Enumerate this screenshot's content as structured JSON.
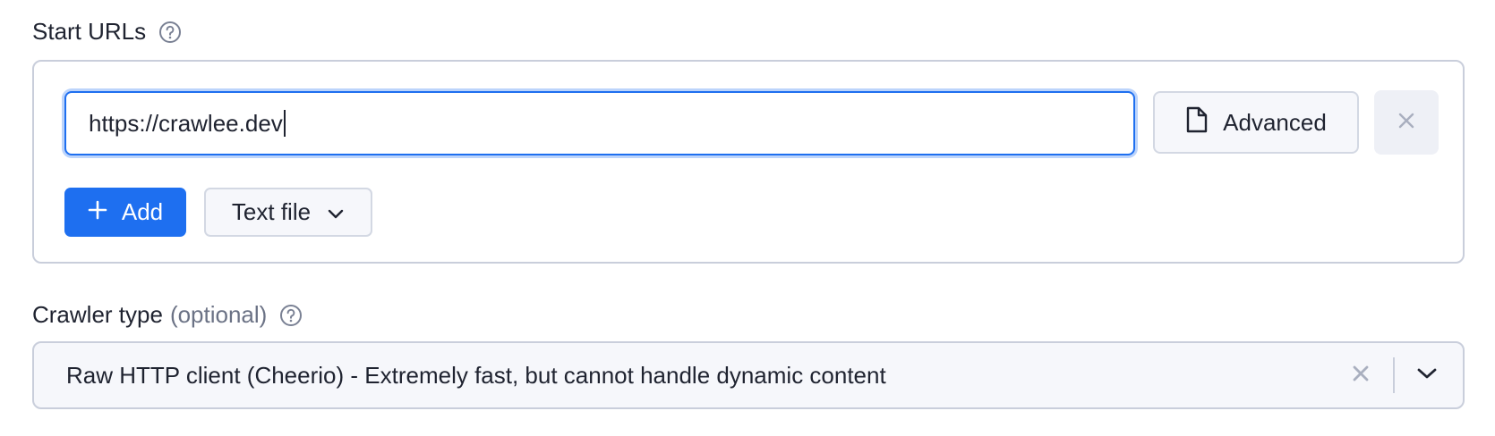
{
  "start_urls": {
    "label": "Start URLs",
    "help_icon": "question-circle-icon",
    "url_value": "https://crawlee.dev",
    "advanced_label": "Advanced",
    "advanced_icon": "file-icon",
    "remove_icon": "close-icon",
    "add_label": "Add",
    "add_icon": "plus-icon",
    "textfile_label": "Text file",
    "textfile_icon": "chevron-down-icon"
  },
  "crawler_type": {
    "label": "Crawler type",
    "optional": "(optional)",
    "help_icon": "question-circle-icon",
    "value": "Raw HTTP client (Cheerio) - Extremely fast, but cannot handle dynamic content",
    "clear_icon": "close-icon",
    "toggle_icon": "chevron-down-icon"
  },
  "colors": {
    "accent": "#1e6ff0",
    "focus_ring": "#bcd4fb",
    "border": "#c9cedb",
    "muted_text": "#6b7285"
  }
}
